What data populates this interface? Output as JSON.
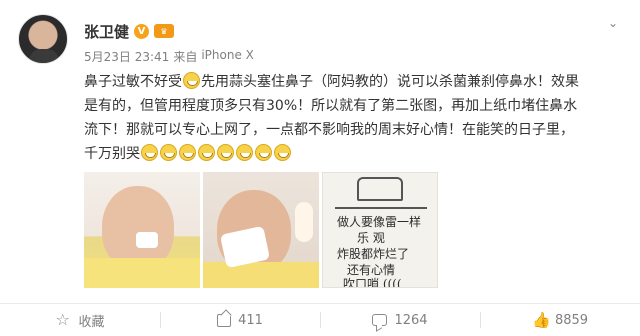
{
  "post": {
    "author": "张卫健",
    "badges": {
      "verified": "V",
      "vip": "♛"
    },
    "date": "5月23日 23:41",
    "source_prefix": "来自",
    "source": "iPhone X",
    "content": {
      "line1_a": "鼻子过敏不好受",
      "line1_b": "先用蒜头塞住鼻子（阿妈教的）说可以杀菌兼刹停鼻水！效果",
      "line2": "是有的，但管用程度顶多只有30%！所以就有了第二张图，再加上纸巾堵住鼻水",
      "line3": "流下！那就可以专心上网了，一点都不影响我的周末好心情！在能笑的日子里，",
      "line4": "千万别哭"
    },
    "photo3_text": [
      "做人要像雷一样",
      "乐 观",
      "炸股都炸烂了",
      "还有心情",
      "吹口哨 (((("
    ]
  },
  "actions": {
    "favorite": "收藏",
    "share": "411",
    "comment": "1264",
    "like": "8859"
  },
  "icons": {
    "more": "chevron-down-icon",
    "favorite": "star-icon",
    "share": "share-icon",
    "comment": "comment-icon",
    "like": "thumbs-up-icon"
  },
  "colors": {
    "text": "#333333",
    "meta": "#808080",
    "accent": "#f7a21b"
  }
}
